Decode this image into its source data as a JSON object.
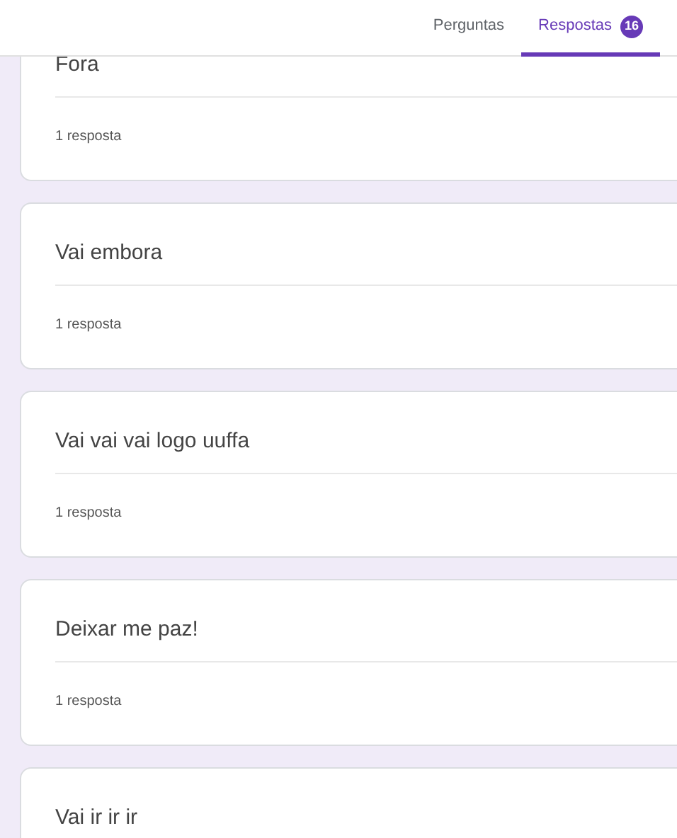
{
  "tabs": [
    {
      "label": "Perguntas",
      "selected": false
    },
    {
      "label": "Respostas",
      "selected": true,
      "badge": "16"
    }
  ],
  "answers": [
    {
      "title": "Fora",
      "count": "1 resposta"
    },
    {
      "title": "Vai embora",
      "count": "1 resposta"
    },
    {
      "title": "Vai vai vai logo uuffa",
      "count": "1 resposta"
    },
    {
      "title": "Deixar me paz!",
      "count": "1 resposta"
    },
    {
      "title": "Vai ir ir ir"
    }
  ]
}
